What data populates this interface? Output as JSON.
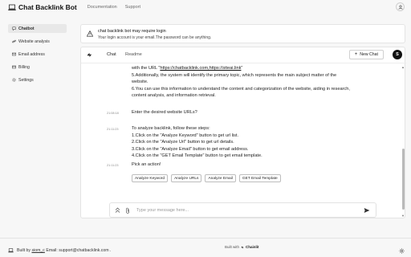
{
  "header": {
    "title": "Chat Backlink Bot",
    "nav": [
      "Documentation",
      "Support"
    ]
  },
  "sidebar": {
    "items": [
      {
        "label": "Chatbot",
        "icon": "chat-bubble-icon",
        "active": true
      },
      {
        "label": "Website analysis",
        "icon": "link-icon"
      },
      {
        "label": "Email address",
        "icon": "mail-icon"
      },
      {
        "label": "Billing",
        "icon": "card-icon"
      },
      {
        "label": "Settings",
        "icon": "gear-icon"
      }
    ]
  },
  "notice": {
    "title": "chat backlink bot may require login",
    "description": "Your login account is your email.The password can be anything."
  },
  "chat": {
    "tabs": [
      "Chat",
      "Readme"
    ],
    "new_chat_label": "New Chat",
    "avatar_initial": "S",
    "messages": {
      "m1_line1_prefix": "with the URL \"",
      "m1_line1_link": "https://chatbacklink.com,https://siteai.link",
      "m1_line1_suffix": "\"",
      "m1_line2": "5.Additionally, the system will identify the primary topic, which represents the main subject matter of the",
      "m1_line3": "website.",
      "m1_line4": "6.You can use this information to understand the content and categorization of the website, aiding in research,",
      "m1_line5": "content analysis, and information retrieval.",
      "m2_time": "21:08:18",
      "m2_text": "Enter the desired website URLs?",
      "m3_time": "21:11:23",
      "m3_line1": "To analyze backlink, follow these steps:",
      "m3_line2": "1.Click on the \"Analyze Keyword\" button to get url list.",
      "m3_line3": "2.Click on the \"Analyze Url\" button to get url details.",
      "m3_line4": "3.Click on the \"Analyze Email\" button to get email address.",
      "m3_line5": "4.Click on the \"GET Email Template\" button to get email template.",
      "m4_time": "21:11:23",
      "m4_text": "Pick an action!"
    },
    "actions": [
      "Analyze Keyword",
      "Analyze URLs",
      "Analyze Email",
      "GET Email Template"
    ]
  },
  "input": {
    "placeholder": "Type your message here..."
  },
  "built_with": {
    "prefix": "Built with",
    "brand": "Chainlit"
  },
  "footer": {
    "built_by": "Built by",
    "author": "siom_c",
    "email_label": "Email:",
    "email": "support@chatbacklink.com",
    "suffix": "."
  }
}
